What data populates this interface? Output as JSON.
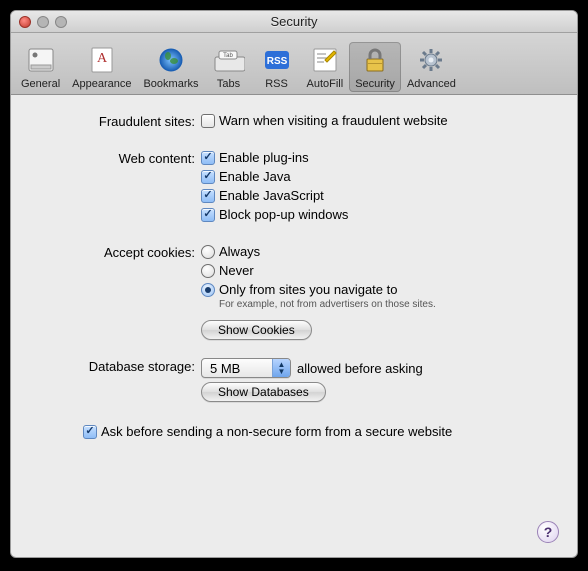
{
  "window": {
    "title": "Security"
  },
  "toolbar": {
    "items": [
      {
        "label": "General"
      },
      {
        "label": "Appearance"
      },
      {
        "label": "Bookmarks"
      },
      {
        "label": "Tabs"
      },
      {
        "label": "RSS"
      },
      {
        "label": "AutoFill"
      },
      {
        "label": "Security"
      },
      {
        "label": "Advanced"
      }
    ]
  },
  "sections": {
    "fraud": {
      "label": "Fraudulent sites:",
      "warn": "Warn when visiting a fraudulent website"
    },
    "webcontent": {
      "label": "Web content:",
      "plugins": "Enable plug-ins",
      "java": "Enable Java",
      "javascript": "Enable JavaScript",
      "popups": "Block pop-up windows"
    },
    "cookies": {
      "label": "Accept cookies:",
      "always": "Always",
      "never": "Never",
      "only": "Only from sites you navigate to",
      "hint": "For example, not from advertisers on those sites.",
      "show": "Show Cookies"
    },
    "database": {
      "label": "Database storage:",
      "value": "5 MB",
      "after": "allowed before asking",
      "show": "Show Databases"
    },
    "secureform": "Ask before sending a non-secure form from a secure website"
  },
  "help": "?"
}
